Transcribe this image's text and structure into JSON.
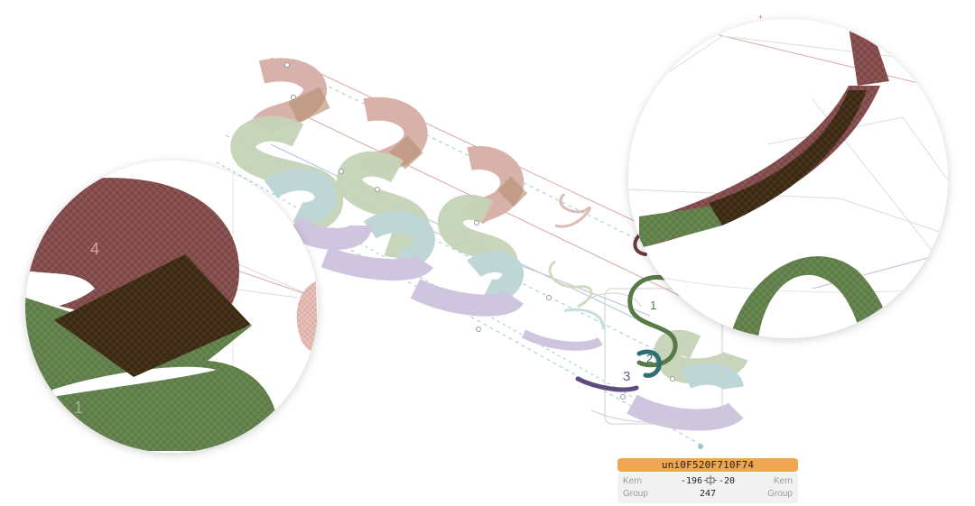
{
  "glyph": {
    "name": "uni0F520F710F74"
  },
  "kerning": {
    "left_label": "Kern",
    "right_label": "Kern",
    "left_value": "-196",
    "right_value": "-20",
    "icon": "kern-link-icon"
  },
  "group": {
    "left_label": "Group",
    "right_label": "Group",
    "value": "247"
  },
  "zoom_left": {
    "marker_top": "4",
    "marker_bottom": "1"
  },
  "canvas_markers": {
    "m1": "1",
    "m2": "2",
    "m3": "3"
  },
  "colors": {
    "layer_1": "#5a7a45",
    "layer_2": "#2f6e70",
    "layer_3": "#6b5a86",
    "layer_4": "#7a3f3f",
    "overlap": "#3b2a14",
    "panel_accent": "#f0a651"
  }
}
